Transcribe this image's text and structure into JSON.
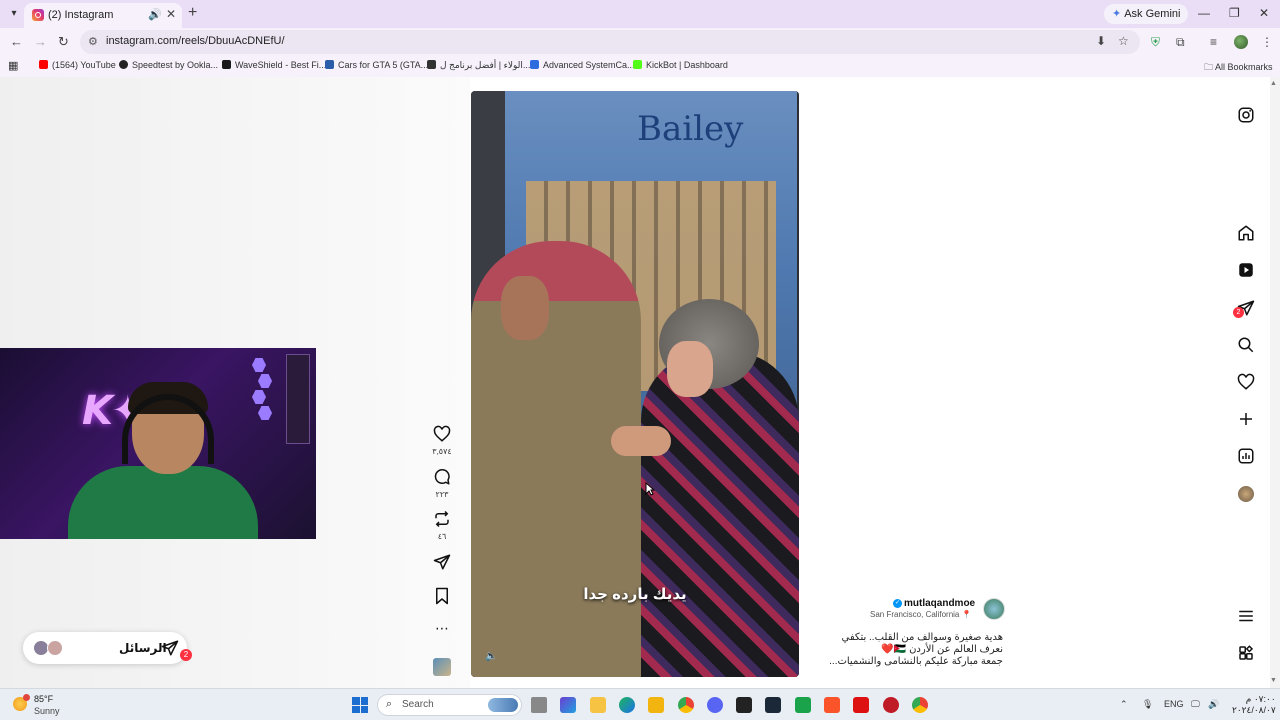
{
  "browser": {
    "tab": {
      "title": "(2) Instagram"
    },
    "gemini_label": "Ask Gemini",
    "url": "instagram.com/reels/DbuuAcDNEfU/",
    "bookmarks": [
      {
        "label": "(1564) YouTube",
        "color": "#ff0000"
      },
      {
        "label": "Speedtest by Ookla...",
        "color": "#222222"
      },
      {
        "label": "WaveShield - Best Fi...",
        "color": "#1a1a1a"
      },
      {
        "label": "Cars for GTA 5 (GTA...",
        "color": "#2a5caa"
      },
      {
        "label": "الولاء | أفضل برنامج ل...",
        "color": "#333333"
      },
      {
        "label": "Advanced SystemCa...",
        "color": "#2d6cdf"
      },
      {
        "label": "KickBot | Dashboard",
        "color": "#53fc18"
      }
    ],
    "all_bookmarks": "All Bookmarks"
  },
  "messages_pill": {
    "label": "الرسائل",
    "badge": "2"
  },
  "actions": {
    "likes": "٣,٥٧٤",
    "comments": "٢٢٣",
    "reposts": "٤٦"
  },
  "video": {
    "sign_text": "Bailey",
    "caption": "يديك بارده جدا"
  },
  "post": {
    "author": "mutlaqandmoe",
    "location": "San Francisco, California",
    "description_lines": [
      "هدية صغيرة وسوالف من القلب.. بتكفي",
      "نعرف العالم عن الأردن 🇯🇴❤️",
      "جمعة مباركة عليكم بالنشامى والنشميات..."
    ]
  },
  "right_rail": {
    "messages_badge": "2"
  },
  "taskbar": {
    "weather_temp": "85°F",
    "weather_desc": "Sunny",
    "search_placeholder": "Search",
    "lang": "ENG",
    "time": "٠٧:٠٠ م",
    "date": "٢٠٢٤/٠٨/٠٧"
  },
  "colors": {
    "tabstrip_bg": "#e9def5",
    "notification_red": "#ff3040",
    "verified_blue": "#0095f6"
  }
}
